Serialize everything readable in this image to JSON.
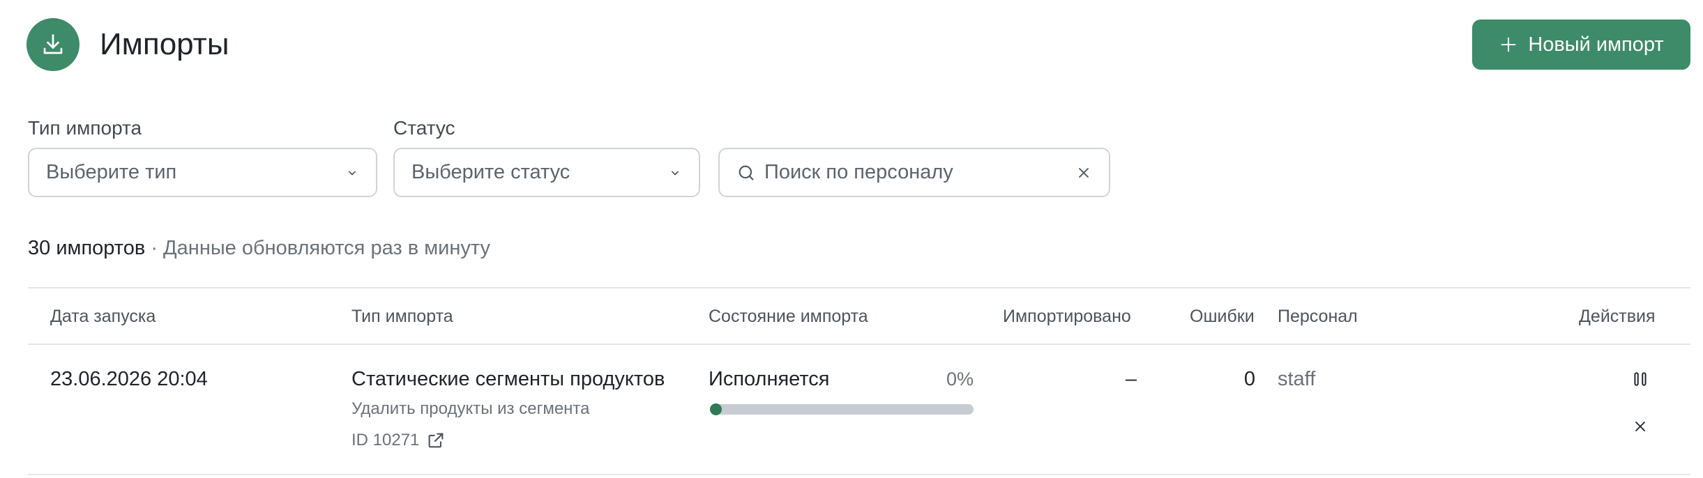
{
  "header": {
    "title": "Импорты",
    "new_button_label": "Новый импорт",
    "icon": "download-icon"
  },
  "filters": {
    "type_label": "Тип импорта",
    "type_placeholder": "Выберите тип",
    "status_label": "Статус",
    "status_placeholder": "Выберите статус",
    "search_placeholder": "Поиск по персоналу"
  },
  "summary": {
    "count": "30 импортов",
    "note": " · Данные обновляются раз в минуту"
  },
  "table": {
    "columns": [
      "Дата запуска",
      "Тип импорта",
      "Состояние импорта",
      "Импортировано",
      "Ошибки",
      "Персонал",
      "Действия"
    ],
    "rows": [
      {
        "date": "23.06.2026 20:04",
        "type": "Статические сегменты продуктов",
        "subtype": "Удалить продукты из сегмента",
        "id": "ID 10271",
        "state": "Исполняется",
        "progress_label": "0%",
        "progress": 0,
        "imported": "–",
        "errors": "0",
        "staff": "staff"
      }
    ]
  },
  "colors": {
    "accent": "#3d8b68",
    "progress_track": "#c7ccd2",
    "progress_fill": "#2f7a55"
  }
}
